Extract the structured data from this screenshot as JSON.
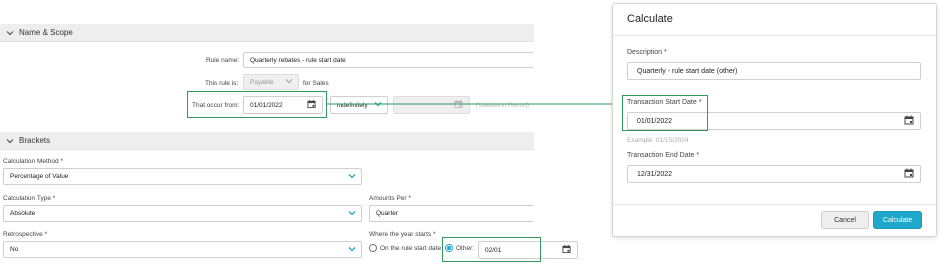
{
  "sections": {
    "name_scope": {
      "title": "Name & Scope"
    },
    "brackets": {
      "title": "Brackets"
    }
  },
  "name_scope": {
    "rule_name_label": "Rule name:",
    "rule_name_value": "Quarterly rebates - rule start date",
    "rule_is_label": "This rule is:",
    "rule_is_value": "Payable",
    "rule_is_suffix": "for Sales",
    "occur_label": "That occur from:",
    "occur_from_value": "01/01/2022",
    "duration_value": "indefinitely",
    "validation_period": "(Validation Period)"
  },
  "brackets": {
    "calc_method_label": "Calculation Method *",
    "calc_method_value": "Percentage of Value",
    "calc_type_label": "Calculation Type *",
    "calc_type_value": "Absolute",
    "amounts_per_label": "Amounts Per *",
    "amounts_per_value": "Quarter",
    "retro_label": "Retrospective *",
    "retro_value": "No",
    "year_starts_label": "Where the year starts *",
    "option_rule_start": "On the rule start date",
    "option_other": "Other:",
    "other_value": "02/01"
  },
  "modal": {
    "title": "Calculate",
    "description_label": "Description *",
    "description_value": "Quarterly - rule start date (other)",
    "start_label": "Transaction Start Date *",
    "start_value": "01/01/2022",
    "start_example": "Example: 01/15/2024",
    "end_label": "Transaction End Date *",
    "end_value": "12/31/2022",
    "cancel_label": "Cancel",
    "calculate_label": "Calculate"
  },
  "colors": {
    "accent": "#1ea8c9",
    "highlight": "#2e9a5a"
  }
}
